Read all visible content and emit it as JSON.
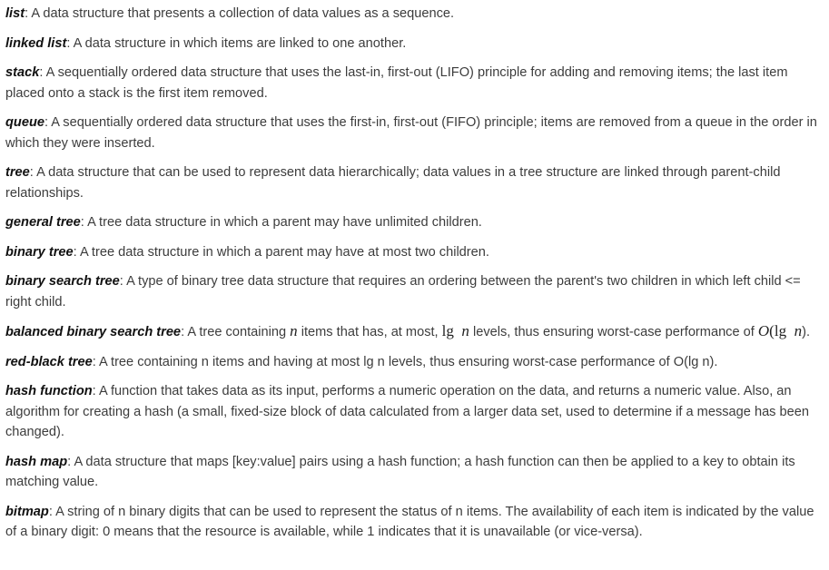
{
  "entries": [
    {
      "term": "list",
      "definition": "A data structure that presents a collection of data values as a sequence."
    },
    {
      "term": "linked list",
      "definition": "A data structure in which items are linked to one another."
    },
    {
      "term": "stack",
      "definition": "A sequentially ordered data structure that uses the last-in, first-out (LIFO) principle for adding and removing items; the last item placed onto a stack is the first item removed."
    },
    {
      "term": "queue",
      "definition": "A sequentially ordered data structure that uses the first-in, first-out (FIFO) principle; items are removed from a queue in the order in which they were inserted."
    },
    {
      "term": "tree",
      "definition": "A data structure that can be used to represent data hierarchically; data values in a tree structure are linked through parent-child relationships."
    },
    {
      "term": "general tree",
      "definition": "A tree data structure in which a parent may have unlimited children."
    },
    {
      "term": "binary tree",
      "definition": "A tree data structure in which a parent may have at most two children."
    },
    {
      "term": "binary search tree",
      "definition": "A type of binary tree data structure that requires an ordering between the parent's two children in which left child <= right child."
    },
    {
      "term": "balanced binary search tree",
      "def_part1": "A tree containing",
      "math_n": "n",
      "def_part2": "items that has, at most,",
      "math_lg": "lg",
      "def_part3": "levels, thus ensuring worst-case performance of",
      "math_O": "O",
      "math_end": ")."
    },
    {
      "term": "red-black tree",
      "definition": "A tree containing n items and having at most lg n levels, thus ensuring worst-case performance of O(lg n)."
    },
    {
      "term": "hash function",
      "definition": "A function that takes data as its input, performs a numeric operation on the data, and returns a numeric value. Also, an algorithm for creating a hash (a small, fixed-size block of data calculated from a larger data set, used to determine if a message has been changed)."
    },
    {
      "term": "hash map",
      "definition": "A data structure that maps [key:value] pairs using a hash function; a hash function can then be applied to a key to obtain its matching value."
    },
    {
      "term": "bitmap",
      "definition": "A string of n binary digits that can be used to represent the status of n items. The availability of each item is indicated by the value of a binary digit: 0 means that the resource is available, while 1 indicates that it is unavailable (or vice-versa)."
    }
  ]
}
